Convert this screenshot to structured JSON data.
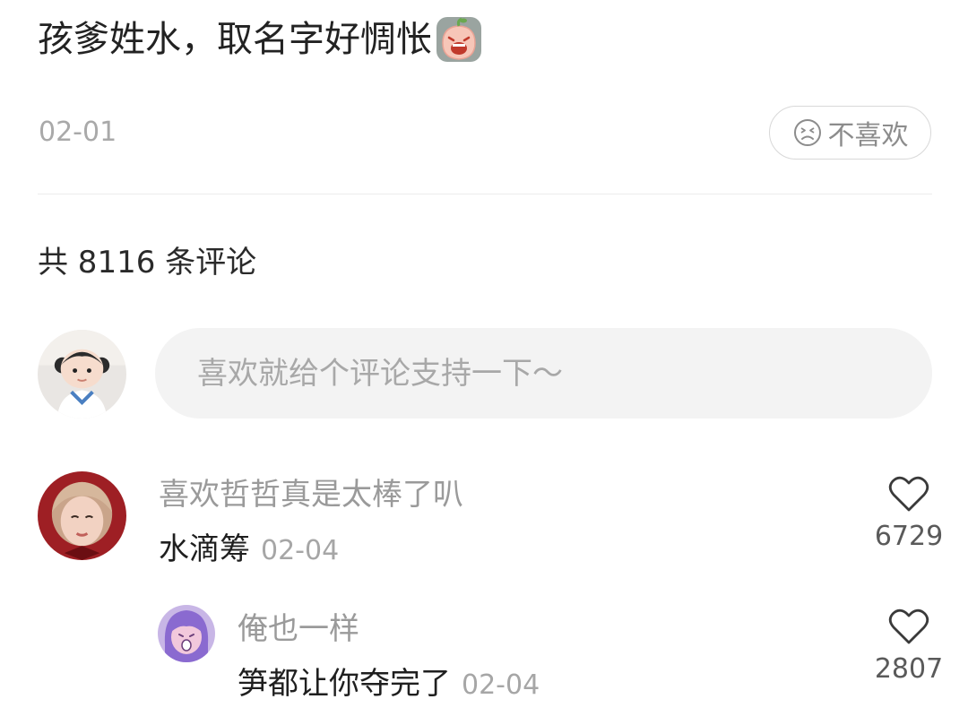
{
  "post": {
    "title": "孩爹姓水，取名字好惆怅",
    "title_emoji": "crying-sticker-icon",
    "date": "02-01",
    "dislike_label": "不喜欢"
  },
  "comments_header": {
    "count_label": "共 8116 条评论"
  },
  "comment_box": {
    "placeholder": "喜欢就给个评论支持一下～"
  },
  "comments": [
    {
      "username": "喜欢哲哲真是太棒了叭",
      "text": "水滴筹",
      "time": "02-04",
      "likes": "6729"
    },
    {
      "username": "俺也一样",
      "text": "笋都让你夺完了",
      "time": "02-04",
      "likes": "2807"
    }
  ],
  "colors": {
    "text_primary": "#222222",
    "text_secondary": "#9a9a9a",
    "input_bg": "#f3f3f3",
    "divider": "#ececec"
  }
}
